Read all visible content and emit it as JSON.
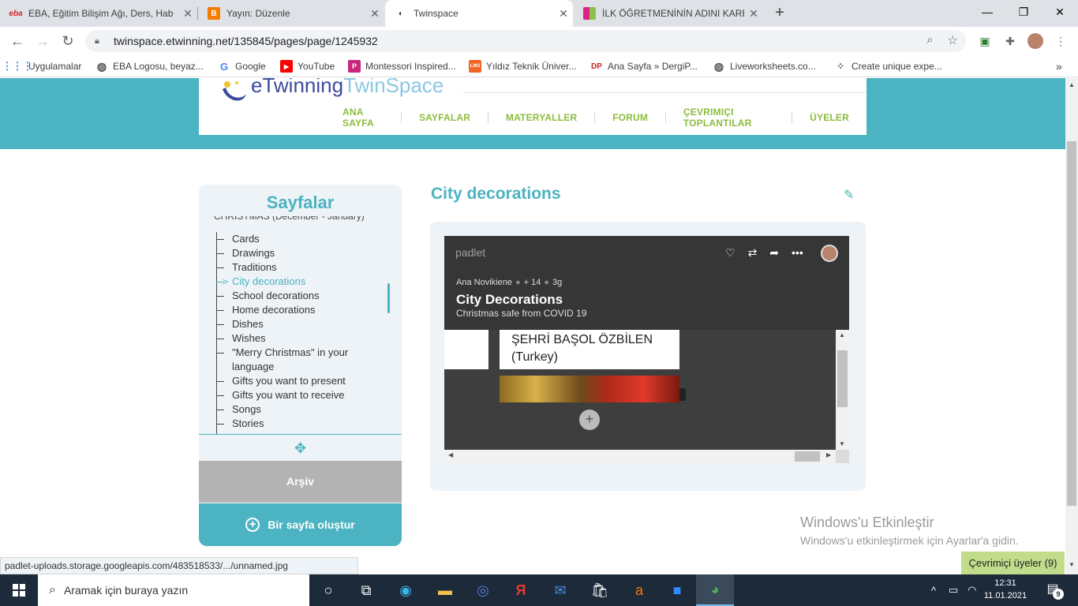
{
  "browser": {
    "tabs": [
      {
        "favicon": "eba",
        "title": "EBA, Eğitim Bilişim Ağı, Ders, Hab"
      },
      {
        "favicon": "blogger",
        "title": "Yayın: Düzenle"
      },
      {
        "favicon": "twinspace",
        "title": "Twinspace"
      },
      {
        "favicon": "kare",
        "title": "İLK ÖĞRETMENİNİN ADINI KARE"
      }
    ],
    "url": "twinspace.etwinning.net/135845/pages/page/1245932",
    "bookmarks": [
      "Uygulamalar",
      "EBA Logosu, beyaz...",
      "Google",
      "YouTube",
      "Montessori Inspired...",
      "Yıldız Teknik Üniver...",
      "Ana Sayfa » DergiP...",
      "Liveworksheets.co...",
      "Create unique expe..."
    ],
    "bookmark_icons": [
      "DP",
      "LMS"
    ]
  },
  "site": {
    "logo_e": "eTwinning",
    "logo_twin": "TwinSpace",
    "nav": [
      "ANA SAYFA",
      "SAYFALAR",
      "MATERYALLER",
      "FORUM",
      "ÇEVRIMIÇI TOPLANTILAR",
      "ÜYELER"
    ]
  },
  "sidebar": {
    "title": "Sayfalar",
    "parent": "CHRISTMAS (December - January)",
    "items": [
      "Cards",
      "Drawings",
      "Traditions",
      "City decorations",
      "School decorations",
      "Home decorations",
      "Dishes",
      "Wishes",
      "\"Merry Christmas\" in your language",
      "Gifts you want to present",
      "Gifts you want to receive",
      "Songs",
      "Stories"
    ],
    "active_item": "City decorations",
    "archive": "Arşiv",
    "create": "Bir sayfa oluştur"
  },
  "main": {
    "title": "City decorations"
  },
  "padlet": {
    "brand": "padlet",
    "author": "Ana Novikiene",
    "likes": "+ 14",
    "age": "3g",
    "title": "City Decorations",
    "subtitle": "Christmas safe from COVID 19",
    "card_text": "ŞEHRİ BAŞOL ÖZBİLEN (Turkey)",
    "add": "+"
  },
  "overlay": {
    "activate_title": "Windows'u Etkinleştir",
    "activate_sub": "Windows'u etkinleştirmek için Ayarlar'a gidin.",
    "online_users": "Çevrimiçi üyeler (9)",
    "status_url": "padlet-uploads.storage.googleapis.com/483518533/.../unnamed.jpg"
  },
  "taskbar": {
    "search_placeholder": "Aramak için buraya yazın",
    "time": "12:31",
    "date": "11.01.2021",
    "notifications": "9"
  },
  "colors": {
    "teal": "#4bb3c1",
    "green_nav": "#8bbd3c",
    "archive_gray": "#b3b3b3"
  }
}
